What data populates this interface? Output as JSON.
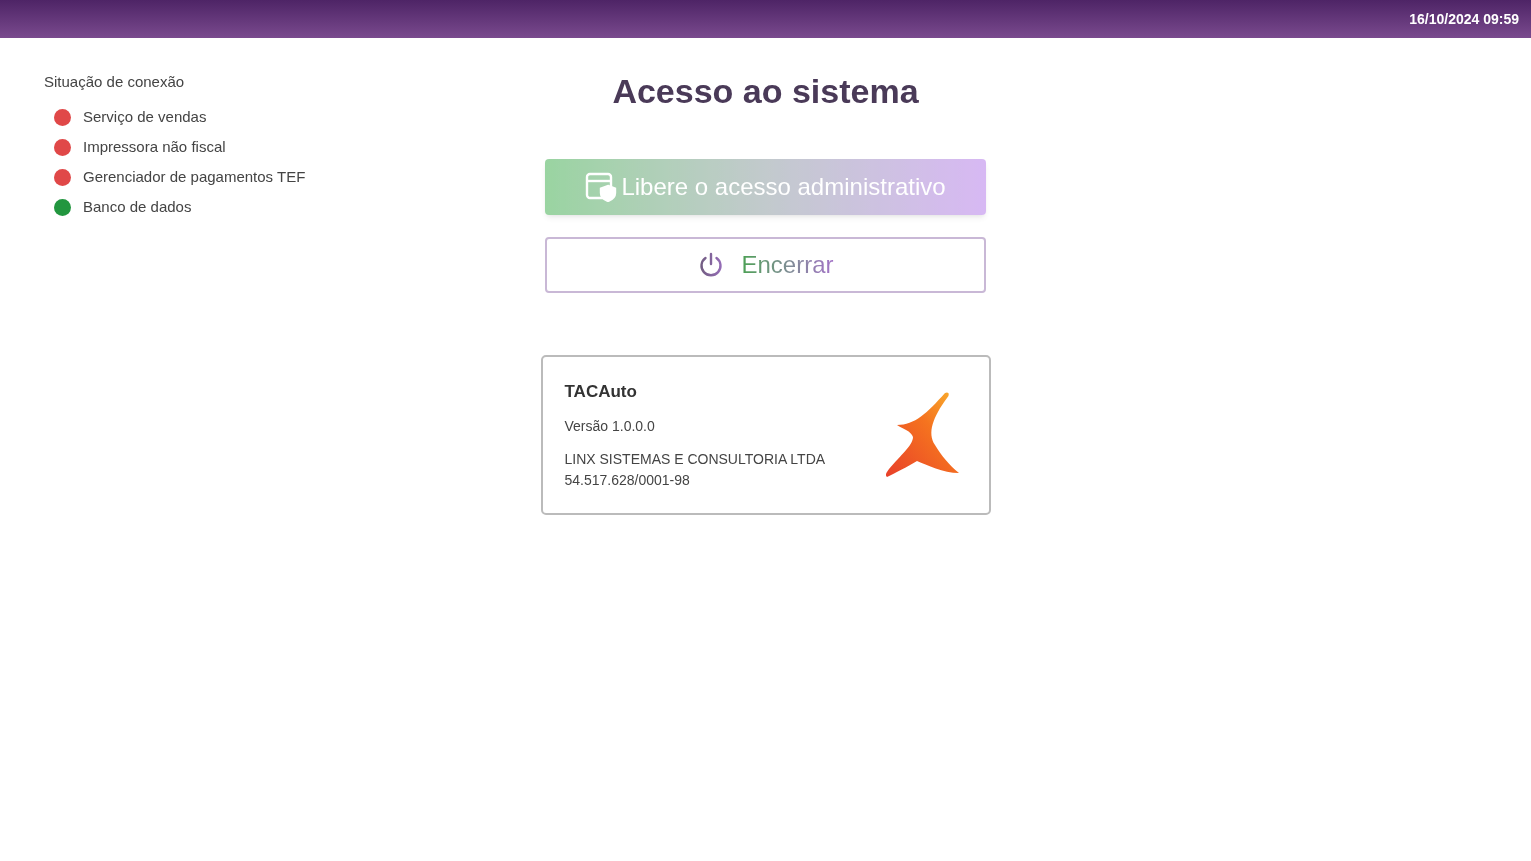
{
  "top_bar": {
    "datetime": "16/10/2024 09:59"
  },
  "connection_status": {
    "title": "Situação de conexão",
    "items": [
      {
        "label": "Serviço de vendas",
        "color": "#e04848"
      },
      {
        "label": "Impressora não fiscal",
        "color": "#e04848"
      },
      {
        "label": "Gerenciador de pagamentos TEF",
        "color": "#e04848"
      },
      {
        "label": "Banco de dados",
        "color": "#22963f"
      }
    ]
  },
  "title": "Acesso ao sistema",
  "buttons": [
    {
      "kind": "admin",
      "label": "Libere o acesso administrativo",
      "disabled": true
    },
    {
      "kind": "power",
      "label": "Encerrar",
      "disabled": false
    }
  ],
  "about": {
    "product": "TACAuto",
    "version": "Versão 1.0.0.0",
    "company": "LINX SISTEMAS E CONSULTORIA LTDA",
    "registration": "54.517.628/0001-98"
  }
}
